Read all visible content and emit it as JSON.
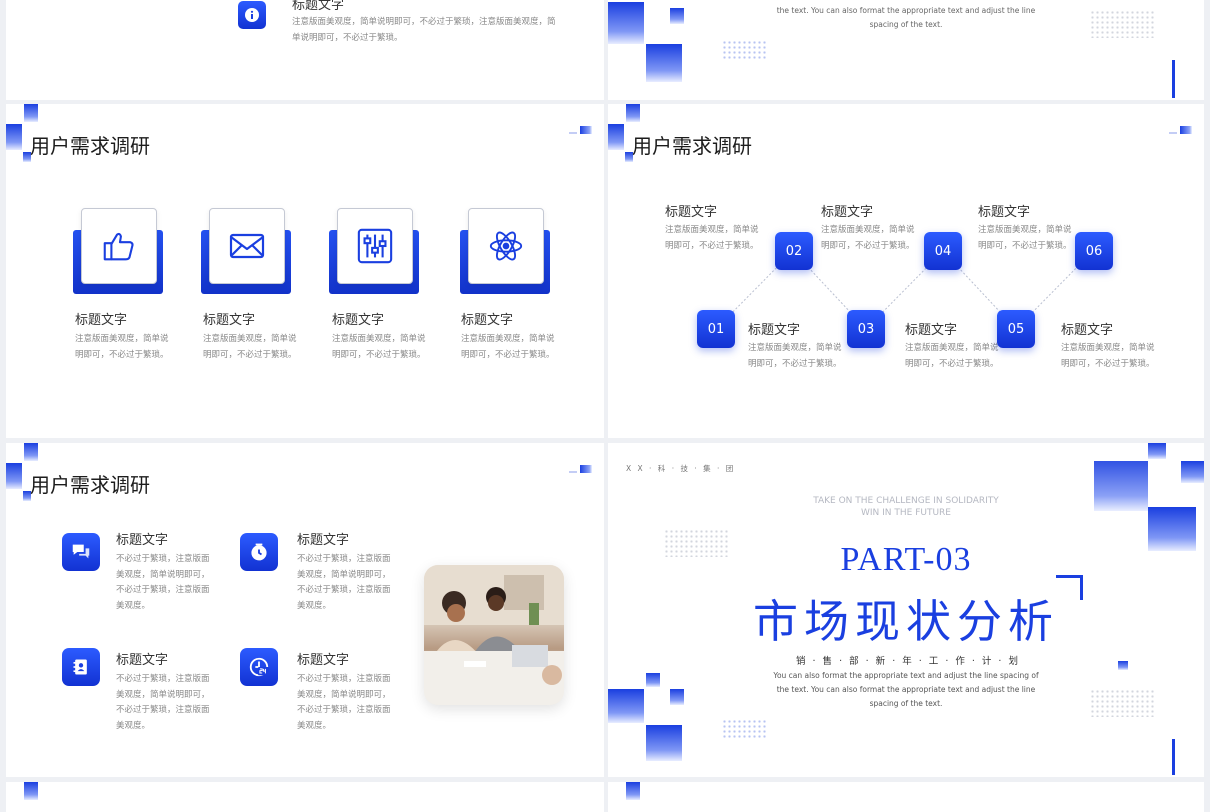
{
  "slide1": {
    "item_title": "标题文字",
    "item_desc": "注意版面美观度，简单说明即可，不必过于繁琐，注意版面美观度，简单说明即可，不必过于繁琐。"
  },
  "slide2": {
    "desc_lines": [
      "the text. You can also format the appropriate text and adjust the line",
      "spacing of the text."
    ]
  },
  "slide3": {
    "title": "用户需求调研",
    "cards": [
      {
        "icon": "thumbs-up-icon",
        "title": "标题文字",
        "desc": "注意版面美观度，简单说明即可，不必过于繁琐。"
      },
      {
        "icon": "mail-icon",
        "title": "标题文字",
        "desc": "注意版面美观度，简单说明即可，不必过于繁琐。"
      },
      {
        "icon": "sliders-icon",
        "title": "标题文字",
        "desc": "注意版面美观度，简单说明即可，不必过于繁琐。"
      },
      {
        "icon": "atom-icon",
        "title": "标题文字",
        "desc": "注意版面美观度，简单说明即可，不必过于繁琐。"
      }
    ]
  },
  "slide4": {
    "title": "用户需求调研",
    "steps": [
      {
        "num": "01",
        "title": "标题文字",
        "desc": "注意版面美观度，简单说明即可，不必过于繁琐。"
      },
      {
        "num": "02",
        "title": "标题文字",
        "desc": "注意版面美观度，简单说明即可，不必过于繁琐。"
      },
      {
        "num": "03",
        "title": "标题文字",
        "desc": "注意版面美观度，简单说明即可，不必过于繁琐。"
      },
      {
        "num": "04",
        "title": "标题文字",
        "desc": "注意版面美观度，简单说明即可，不必过于繁琐。"
      },
      {
        "num": "05",
        "title": "标题文字",
        "desc": "注意版面美观度，简单说明即可，不必过于繁琐。"
      },
      {
        "num": "06",
        "title": "标题文字",
        "desc": "注意版面美观度，简单说明即可，不必过于繁琐。"
      }
    ]
  },
  "slide5": {
    "title": "用户需求调研",
    "items": [
      {
        "icon": "chat-bubbles-icon",
        "title": "标题文字",
        "desc": "不必过于繁琐，注意版面美观度，简单说明即可，不必过于繁琐，注意版面美观度。"
      },
      {
        "icon": "clock-icon",
        "title": "标题文字",
        "desc": "不必过于繁琐，注意版面美观度，简单说明即可，不必过于繁琐，注意版面美观度。"
      },
      {
        "icon": "contact-book-icon",
        "title": "标题文字",
        "desc": "不必过于繁琐，注意版面美观度，简单说明即可，不必过于繁琐，注意版面美观度。"
      },
      {
        "icon": "24-hours-icon",
        "title": "标题文字",
        "desc": "不必过于繁琐，注意版面美观度，简单说明即可，不必过于繁琐，注意版面美观度。"
      }
    ]
  },
  "slide6": {
    "company": "X X · 科 · 技 · 集 · 团",
    "tagline_1": "TAKE ON THE CHALLENGE IN SOLIDARITY",
    "tagline_2": "WIN IN THE FUTURE",
    "part": "PART-03",
    "heading": "市场现状分析",
    "subheading": "销 · 售 · 部 · 新 · 年 · 工 · 作 · 计 · 划",
    "desc_lines": [
      "You can also format the appropriate text and adjust the line spacing of",
      "the text. You can also format the appropriate text and adjust the line",
      "spacing of the text."
    ]
  },
  "colors": {
    "accent": "#1a3fe0",
    "title": "#1c1c1c",
    "body": "#888888"
  }
}
